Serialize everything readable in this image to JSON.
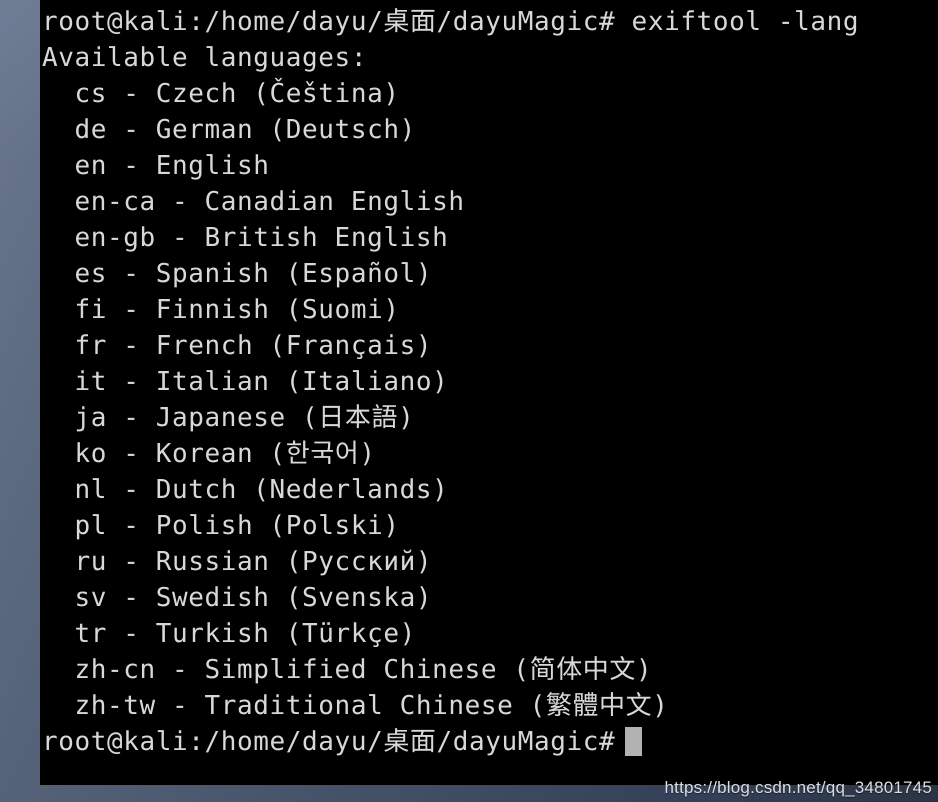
{
  "window": {
    "app": "terminal",
    "background_color": "#000000",
    "text_color": "#d8d8d8",
    "cursor_color": "#b2b2b2"
  },
  "desktop": {
    "wallpaper_gradient_from": "#6b7890",
    "wallpaper_gradient_to": "#2b3444"
  },
  "terminal": {
    "prompt": "root@kali:/home/dayu/桌面/dayuMagic#",
    "command": "exiftool -lang",
    "command_line": "root@kali:/home/dayu/桌面/dayuMagic# exiftool -lang",
    "output_header": "Available languages:",
    "final_prompt": "root@kali:/home/dayu/桌面/dayuMagic#",
    "lines": [
      "root@kali:/home/dayu/桌面/dayuMagic# exiftool -lang",
      "Available languages:",
      "  cs - Czech (Čeština)",
      "  de - German (Deutsch)",
      "  en - English",
      "  en-ca - Canadian English",
      "  en-gb - British English",
      "  es - Spanish (Español)",
      "  fi - Finnish (Suomi)",
      "  fr - French (Français)",
      "  it - Italian (Italiano)",
      "  ja - Japanese (日本語)",
      "  ko - Korean (한국어)",
      "  nl - Dutch (Nederlands)",
      "  pl - Polish (Polski)",
      "  ru - Russian (Русский)",
      "  sv - Swedish (Svenska)",
      "  tr - Turkish (Türkçe)",
      "  zh-cn - Simplified Chinese (简体中文)",
      "  zh-tw - Traditional Chinese (繁體中文)",
      "root@kali:/home/dayu/桌面/dayuMagic#"
    ],
    "languages": [
      {
        "code": "cs",
        "name": "Czech",
        "native": "Čeština"
      },
      {
        "code": "de",
        "name": "German",
        "native": "Deutsch"
      },
      {
        "code": "en",
        "name": "English",
        "native": ""
      },
      {
        "code": "en-ca",
        "name": "Canadian English",
        "native": ""
      },
      {
        "code": "en-gb",
        "name": "British English",
        "native": ""
      },
      {
        "code": "es",
        "name": "Spanish",
        "native": "Español"
      },
      {
        "code": "fi",
        "name": "Finnish",
        "native": "Suomi"
      },
      {
        "code": "fr",
        "name": "French",
        "native": "Français"
      },
      {
        "code": "it",
        "name": "Italian",
        "native": "Italiano"
      },
      {
        "code": "ja",
        "name": "Japanese",
        "native": "日本語"
      },
      {
        "code": "ko",
        "name": "Korean",
        "native": "한국어"
      },
      {
        "code": "nl",
        "name": "Dutch",
        "native": "Nederlands"
      },
      {
        "code": "pl",
        "name": "Polish",
        "native": "Polski"
      },
      {
        "code": "ru",
        "name": "Russian",
        "native": "Русский"
      },
      {
        "code": "sv",
        "name": "Swedish",
        "native": "Svenska"
      },
      {
        "code": "tr",
        "name": "Turkish",
        "native": "Türkçe"
      },
      {
        "code": "zh-cn",
        "name": "Simplified Chinese",
        "native": "简体中文"
      },
      {
        "code": "zh-tw",
        "name": "Traditional Chinese",
        "native": "繁體中文"
      }
    ]
  },
  "watermark": {
    "text": "https://blog.csdn.net/qq_34801745"
  }
}
